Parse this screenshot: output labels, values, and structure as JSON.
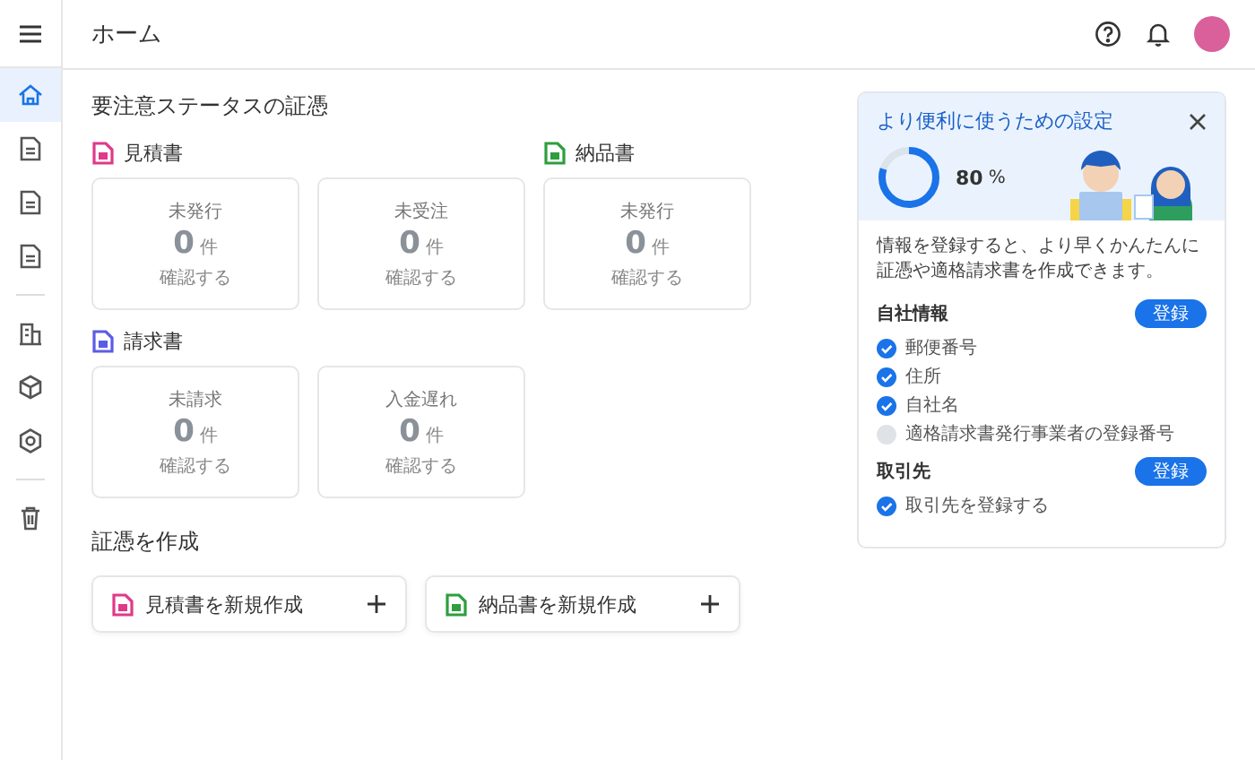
{
  "header": {
    "title": "ホーム"
  },
  "sidebar": {
    "groups": [
      {
        "items": [
          {
            "selected": true
          },
          {
            "selected": false
          },
          {
            "selected": false
          },
          {
            "selected": false
          }
        ]
      },
      {
        "items": [
          {
            "selected": false
          },
          {
            "selected": false
          },
          {
            "selected": false
          }
        ]
      },
      {
        "items": [
          {
            "selected": false
          }
        ]
      }
    ]
  },
  "status_section": {
    "title": "要注意ステータスの証憑",
    "groups": [
      {
        "label": "見積書",
        "color": "#e0398a",
        "cards": [
          {
            "label": "未発行",
            "count": "0",
            "unit": "件",
            "link": "確認する"
          },
          {
            "label": "未受注",
            "count": "0",
            "unit": "件",
            "link": "確認する"
          }
        ]
      },
      {
        "label": "納品書",
        "color": "#2e9e3e",
        "cards": [
          {
            "label": "未発行",
            "count": "0",
            "unit": "件",
            "link": "確認する"
          }
        ]
      },
      {
        "label": "請求書",
        "color": "#5b5ce6",
        "cards": [
          {
            "label": "未請求",
            "count": "0",
            "unit": "件",
            "link": "確認する"
          },
          {
            "label": "入金遅れ",
            "count": "0",
            "unit": "件",
            "link": "確認する"
          }
        ]
      }
    ]
  },
  "create_section": {
    "title": "証憑を作成",
    "cards": [
      {
        "label": "見積書を新規作成",
        "color": "#e0398a"
      },
      {
        "label": "納品書を新規作成",
        "color": "#2e9e3e"
      }
    ]
  },
  "setup_panel": {
    "title": "より便利に使うための設定",
    "progress": {
      "level": 0.8,
      "value": "80",
      "unit": "%"
    },
    "description": "情報を登録すると、より早くかんたんに証憑や適格請求書を作成できます。",
    "sections": [
      {
        "title": "自社情報",
        "button": "登録",
        "items": [
          {
            "label": "郵便番号",
            "checked": true
          },
          {
            "label": "住所",
            "checked": true
          },
          {
            "label": "自社名",
            "checked": true
          },
          {
            "label": "適格請求書発行事業者の登録番号",
            "checked": false
          }
        ]
      },
      {
        "title": "取引先",
        "button": "登録",
        "items": [
          {
            "label": "取引先を登録する",
            "checked": true
          }
        ]
      }
    ]
  }
}
